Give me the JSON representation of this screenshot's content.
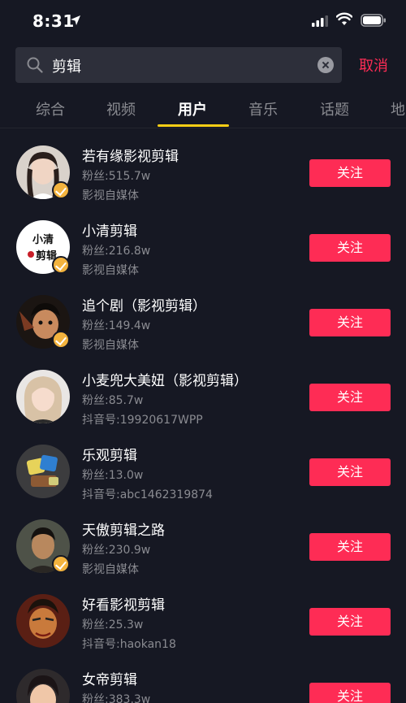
{
  "status_bar": {
    "time": "8:31"
  },
  "search": {
    "query": "剪辑",
    "cancel_label": "取消"
  },
  "tabs": [
    {
      "label": "综合"
    },
    {
      "label": "视频"
    },
    {
      "label": "用户"
    },
    {
      "label": "音乐"
    },
    {
      "label": "话题"
    },
    {
      "label": "地"
    }
  ],
  "active_tab": "用户",
  "users": [
    {
      "name": "若有缘影视剪辑",
      "fans": "粉丝:515.7w",
      "sub": "影视自媒体",
      "verified": true,
      "follow_label": "关注"
    },
    {
      "name": "小清剪辑",
      "fans": "粉丝:216.8w",
      "sub": "影视自媒体",
      "verified": true,
      "follow_label": "关注",
      "avatar_text": "小清\n剪辑"
    },
    {
      "name": "追个剧（影视剪辑）",
      "fans": "粉丝:149.4w",
      "sub": "影视自媒体",
      "verified": true,
      "follow_label": "关注"
    },
    {
      "name": "小麦兜大美妞（影视剪辑）",
      "fans": "粉丝:85.7w",
      "sub": "抖音号:19920617WPP",
      "verified": false,
      "follow_label": "关注"
    },
    {
      "name": "乐观剪辑",
      "fans": "粉丝:13.0w",
      "sub": "抖音号:abc1462319874",
      "verified": false,
      "follow_label": "关注"
    },
    {
      "name": "天傲剪辑之路",
      "fans": "粉丝:230.9w",
      "sub": "影视自媒体",
      "verified": true,
      "follow_label": "关注"
    },
    {
      "name": "好看影视剪辑",
      "fans": "粉丝:25.3w",
      "sub": "抖音号:haokan18",
      "verified": false,
      "follow_label": "关注"
    },
    {
      "name": "女帝剪辑",
      "fans": "粉丝:383.3w",
      "sub": "",
      "verified": false,
      "follow_label": "关注"
    }
  ],
  "colors": {
    "background": "#161823",
    "accent": "#fe2c55",
    "tab_indicator": "#face15",
    "verify_badge": "#f3b33e"
  }
}
